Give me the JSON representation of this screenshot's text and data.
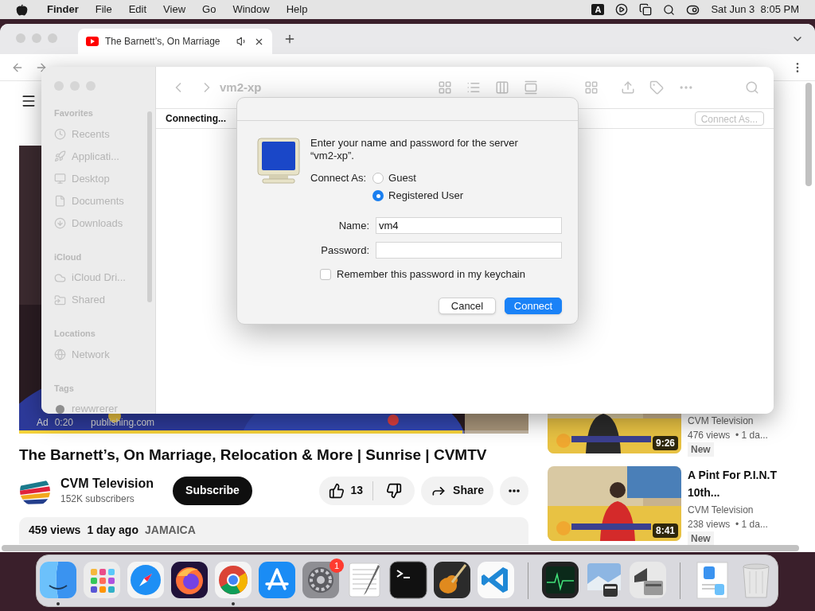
{
  "menu_bar": {
    "app": "Finder",
    "menus": [
      "File",
      "Edit",
      "View",
      "Go",
      "Window",
      "Help"
    ],
    "input_source": "A",
    "clock": "Sat Jun 3  8:05 PM"
  },
  "browser": {
    "tab": {
      "title": "The Barnett’s, On Marriage",
      "selected": true
    }
  },
  "youtube": {
    "ad": {
      "label": "Ad",
      "time": "0:20",
      "domain": "publishing.com"
    },
    "progress": {
      "level": 0.87
    },
    "title": "The Barnett’s, On Marriage, Relocation & More | Sunrise | CVMTV",
    "channel": {
      "name": "CVM Television",
      "subscribers": "152K subscribers"
    },
    "subscribe": "Subscribe",
    "likes": "13",
    "share": "Share",
    "description": {
      "views": "459 views",
      "age": "1 day ago",
      "tag": "JAMAICA"
    },
    "related": [
      {
        "channel": "CVM Television",
        "meta": "476 views  • 1 da...",
        "badge": "New",
        "duration": "9:26"
      },
      {
        "title": "A Pint For P.I.N.T 10th...",
        "channel": "CVM Television",
        "meta": "238 views  • 1 da...",
        "badge": "New",
        "duration": "8:41"
      }
    ]
  },
  "finder": {
    "title": "vm2-xp",
    "status": "Connecting...",
    "connect_as": "Connect As...",
    "sidebar": [
      {
        "heading": "Favorites",
        "items": [
          {
            "kind": "recents",
            "label": "Recents"
          },
          {
            "kind": "applications",
            "label": "Applicati..."
          },
          {
            "kind": "desktop",
            "label": "Desktop"
          },
          {
            "kind": "documents",
            "label": "Documents"
          },
          {
            "kind": "downloads",
            "label": "Downloads"
          }
        ]
      },
      {
        "heading": "iCloud",
        "items": [
          {
            "kind": "cloud",
            "label": "iCloud Dri..."
          },
          {
            "kind": "shared",
            "label": "Shared"
          }
        ]
      },
      {
        "heading": "Locations",
        "items": [
          {
            "kind": "network",
            "label": "Network"
          }
        ]
      },
      {
        "heading": "Tags",
        "items": [
          {
            "kind": "tag",
            "label": "rewwrerer",
            "color": "#8e8e8e"
          }
        ]
      }
    ]
  },
  "dialog": {
    "prompt": "Enter your name and password for the server “vm2-xp”.",
    "connect_as_label": "Connect As:",
    "options": [
      {
        "label": "Guest",
        "selected": false
      },
      {
        "label": "Registered User",
        "selected": true
      }
    ],
    "name_label": "Name:",
    "name_value": "vm4",
    "password_label": "Password:",
    "remember": {
      "label": "Remember this password in my keychain",
      "checked": false
    },
    "buttons": [
      {
        "label": "Cancel",
        "kind": "secondary"
      },
      {
        "label": "Connect",
        "kind": "primary"
      }
    ]
  },
  "dock": {
    "apps": [
      {
        "kind": "finder",
        "running": true
      },
      {
        "kind": "launchpad",
        "running": false
      },
      {
        "kind": "safari",
        "running": false
      },
      {
        "kind": "firefox",
        "running": false
      },
      {
        "kind": "chrome",
        "running": true
      },
      {
        "kind": "appstore",
        "running": false
      },
      {
        "kind": "settings",
        "running": false,
        "badge": "1"
      },
      {
        "kind": "textedit",
        "running": false
      },
      {
        "kind": "terminal",
        "running": false
      },
      {
        "kind": "garageband",
        "running": false
      },
      {
        "kind": "vscode",
        "running": false
      },
      {
        "kind": "separator"
      },
      {
        "kind": "activity",
        "running": false
      },
      {
        "kind": "preview",
        "running": false
      },
      {
        "kind": "bootcamp",
        "running": false
      },
      {
        "kind": "separator"
      },
      {
        "kind": "document",
        "running": false
      },
      {
        "kind": "trash",
        "running": false
      }
    ]
  }
}
